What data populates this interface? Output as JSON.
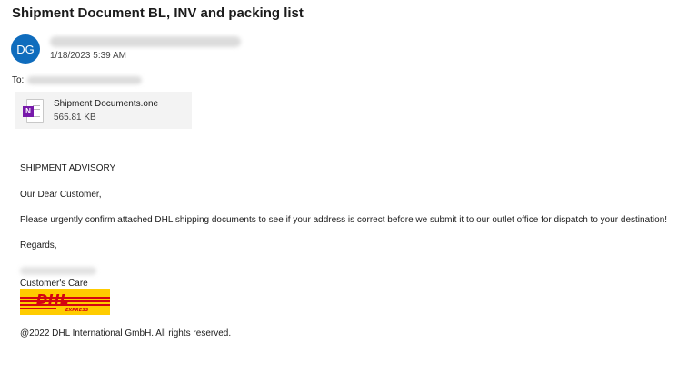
{
  "email": {
    "subject": "Shipment Document BL, INV and packing list",
    "sender_initials": "DG",
    "date": "1/18/2023 5:39 AM",
    "to_label": "To:"
  },
  "attachment": {
    "filename": "Shipment Documents.one",
    "size": "565.81 KB",
    "icon": "onenote-file-icon",
    "icon_letter": "N",
    "icon_color": "#7719aa"
  },
  "message": {
    "heading": "SHIPMENT ADVISORY",
    "greeting": "Our Dear Customer,",
    "paragraph": "Please urgently confirm attached DHL shipping documents to see if your address is correct before we submit it to our outlet office for dispatch to your destination!",
    "closing": "Regards,",
    "signature_title": "Customer's Care",
    "footer": "@2022 DHL International GmbH. All rights reserved."
  },
  "logo": {
    "text": "DHL",
    "subtext": "EXPRESS",
    "background": "#ffcc00",
    "color": "#d40511"
  },
  "colors": {
    "avatar": "#0f6cbd",
    "attachment_bg": "#f3f3f3"
  }
}
